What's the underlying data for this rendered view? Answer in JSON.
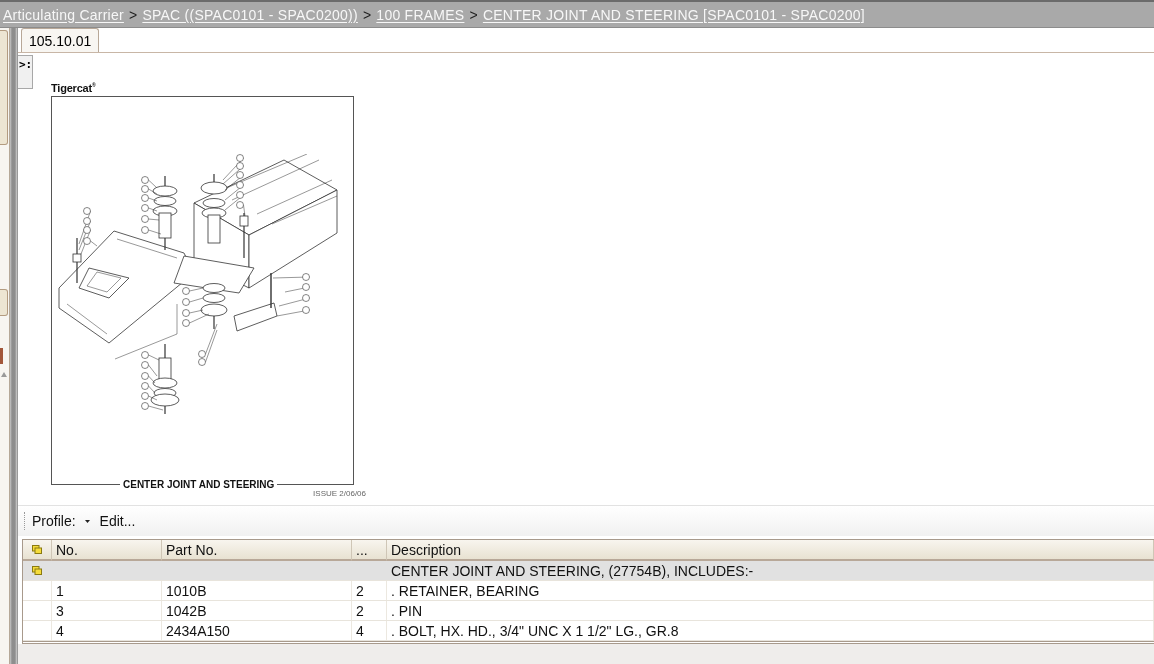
{
  "breadcrumb": [
    {
      "kind": "link",
      "text": "Articulating Carrier"
    },
    {
      "kind": "separator",
      "text": ">"
    },
    {
      "kind": "link",
      "text": "SPAC ((SPAC0101 - SPAC0200))"
    },
    {
      "kind": "separator",
      "text": ">"
    },
    {
      "kind": "link",
      "text": "100 FRAMES"
    },
    {
      "kind": "separator",
      "text": ">"
    },
    {
      "kind": "link",
      "text": "CENTER JOINT AND STEERING [SPAC0101 - SPAC0200]"
    }
  ],
  "tabs": [
    {
      "label": "105.10.01",
      "selected": true
    }
  ],
  "panel_toggle": {
    "label": ">:"
  },
  "drawing": {
    "brand": "Tigercat$^{®}$",
    "caption": "CENTER JOINT AND STEERING",
    "issue": "ISSUE 2/06/06"
  },
  "toolbar": {
    "profile": "Profile:",
    "edit": "Edit..."
  },
  "table": {
    "columns": [
      {
        "kind": "icon"
      },
      {
        "kind": "text",
        "label": "No."
      },
      {
        "kind": "text",
        "label": "Part No."
      },
      {
        "kind": "text",
        "label": "..."
      },
      {
        "kind": "text",
        "label": "Description"
      }
    ],
    "rows": [
      {
        "kind": "assembly",
        "description": "CENTER JOINT AND STEERING, (27754B), INCLUDES:-"
      },
      {
        "kind": "part",
        "no": "1",
        "part_no": "1010B",
        "column_4": "2",
        "description": ". RETAINER, BEARING"
      },
      {
        "kind": "part",
        "no": "3",
        "part_no": "1042B",
        "column_4": "2",
        "description": ". PIN"
      },
      {
        "kind": "part",
        "no": "4",
        "part_no": "2434A150",
        "column_4": "4",
        "description": ". BOLT, HX. HD., 3/4\" UNC X 1 1/2\" LG., GR.8"
      }
    ]
  }
}
